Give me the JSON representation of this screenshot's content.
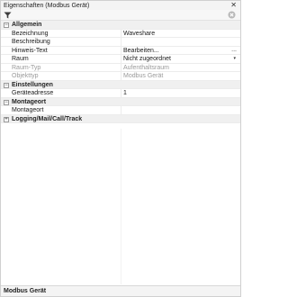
{
  "window": {
    "title": "Eigenschaften (Modbus Gerät)",
    "close_glyph": "✕"
  },
  "toolbar": {
    "filter_icon": "filter-icon",
    "clear_icon": "clear-filter-icon"
  },
  "categories": {
    "allgemein": {
      "label": "Allgemein",
      "expander": "−",
      "rows": {
        "bezeichnung": {
          "name": "Bezeichnung",
          "value": "Waveshare"
        },
        "beschreibung": {
          "name": "Beschreibung",
          "value": ""
        },
        "hinweis": {
          "name": "Hinweis-Text",
          "value": "Bearbeiten...",
          "button": "..."
        },
        "raum": {
          "name": "Raum",
          "value": "Nicht zugeordnet",
          "dropdown": "▾"
        },
        "raumtyp": {
          "name": "Raum-Typ",
          "value": "Aufenthaltsraum"
        },
        "objekttyp": {
          "name": "Objekttyp",
          "value": "Modbus Gerät"
        }
      }
    },
    "einstellungen": {
      "label": "Einstellungen",
      "expander": "−",
      "rows": {
        "geraeteadresse": {
          "name": "Geräteadresse",
          "value": "1"
        }
      }
    },
    "montageort": {
      "label": "Montageort",
      "expander": "−",
      "rows": {
        "montageort": {
          "name": "Montageort",
          "value": ""
        }
      }
    },
    "logging": {
      "label": "Logging/Mail/Call/Track",
      "expander": "+"
    }
  },
  "status": {
    "text": "Modbus Gerät"
  }
}
